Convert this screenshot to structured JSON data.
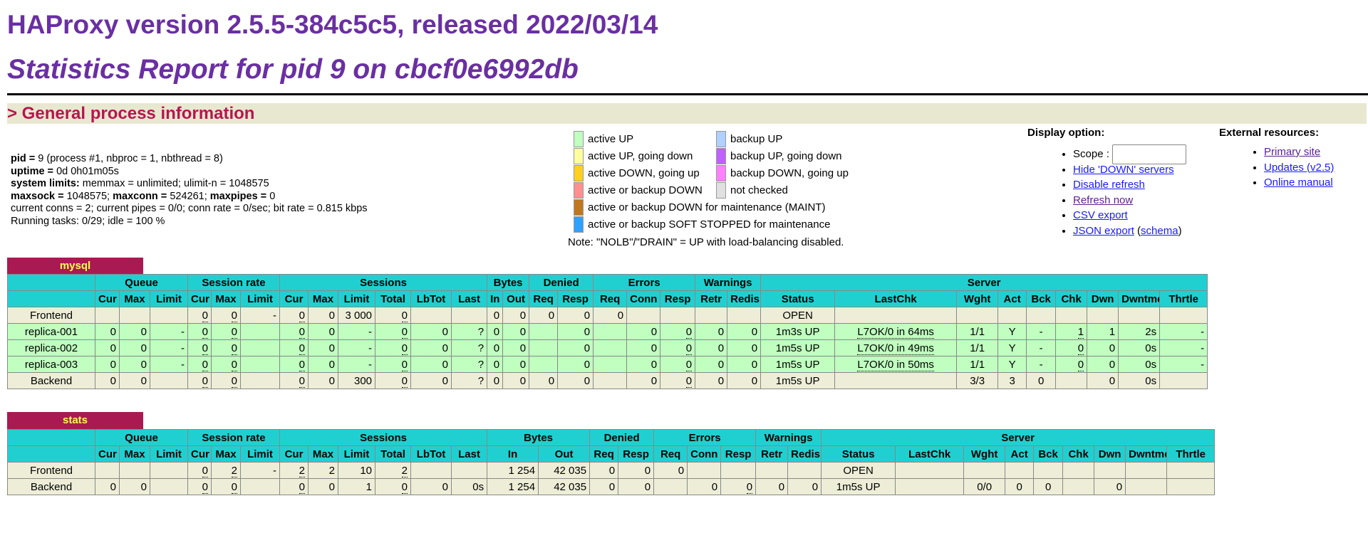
{
  "header": {
    "title": "HAProxy version 2.5.5-384c5c5, released 2022/03/14",
    "subtitle": "Statistics Report for pid 9 on cbcf0e6992db"
  },
  "section": {
    "title": "> General process information"
  },
  "process_info": [
    {
      "bold": "pid = ",
      "rest": "9 (process #1, nbproc = 1, nbthread = 8)"
    },
    {
      "bold": "uptime = ",
      "rest": "0d 0h01m05s"
    },
    {
      "bold": "system limits: ",
      "rest": "memmax = unlimited; ulimit-n = 1048575"
    },
    {
      "bold": "maxsock = ",
      "rest": "1048575; ",
      "bold2": "maxconn = ",
      "rest2": "524261; ",
      "bold3": "maxpipes = ",
      "rest3": "0"
    },
    {
      "bold": "",
      "rest": "current conns = 2; current pipes = 0/0; conn rate = 0/sec; bit rate = 0.815 kbps"
    },
    {
      "bold": "",
      "rest": "Running tasks: 0/29; idle = 100 %"
    }
  ],
  "legend": {
    "left": [
      {
        "label": "active UP",
        "color": "#c0ffc0"
      },
      {
        "label": "active UP, going down",
        "color": "#ffffa0"
      },
      {
        "label": "active DOWN, going up",
        "color": "#ffd020"
      },
      {
        "label": "active or backup DOWN",
        "color": "#ff9090"
      },
      {
        "label": "active or backup DOWN for maintenance (MAINT)",
        "color": "#c07820"
      },
      {
        "label": "active or backup SOFT STOPPED for maintenance",
        "color": "#30a0ff"
      }
    ],
    "right": [
      {
        "label": "backup UP",
        "color": "#b0d0ff"
      },
      {
        "label": "backup UP, going down",
        "color": "#c060ff"
      },
      {
        "label": "backup DOWN, going up",
        "color": "#ff80ff"
      },
      {
        "label": "not checked",
        "color": "#e0e0e0"
      }
    ],
    "note": "Note: \"NOLB\"/\"DRAIN\" = UP with load-balancing disabled."
  },
  "display_options": {
    "title": "Display option:",
    "scope_label": "Scope :",
    "scope_value": "",
    "links": [
      "Hide 'DOWN' servers",
      "Disable refresh",
      "Refresh now",
      "CSV export",
      "JSON export",
      "schema"
    ]
  },
  "external_resources": {
    "title": "External resources:",
    "links": [
      "Primary site",
      "Updates (v2.5)",
      "Online manual"
    ]
  },
  "headers_top": [
    "",
    "Queue",
    "Session rate",
    "Sessions",
    "Bytes",
    "Denied",
    "Errors",
    "Warnings",
    "Server"
  ],
  "headers_sub": [
    "",
    "Cur",
    "Max",
    "Limit",
    "Cur",
    "Max",
    "Limit",
    "Cur",
    "Max",
    "Limit",
    "Total",
    "LbTot",
    "Last",
    "In",
    "Out",
    "Req",
    "Resp",
    "Req",
    "Conn",
    "Resp",
    "Retr",
    "Redis",
    "Status",
    "LastChk",
    "Wght",
    "Act",
    "Bck",
    "Chk",
    "Dwn",
    "Dwntme",
    "Thrtle"
  ],
  "proxies": [
    {
      "name": "mysql",
      "rows": [
        {
          "type": "frontend",
          "cells": [
            "Frontend",
            "",
            "",
            "",
            "0",
            "0",
            "-",
            "0",
            "0",
            "3 000",
            "0",
            "",
            "",
            "0",
            "0",
            "0",
            "0",
            "0",
            "",
            "",
            "",
            "",
            "OPEN",
            "",
            "",
            "",
            "",
            "",
            "",
            "",
            ""
          ]
        },
        {
          "type": "up",
          "cells": [
            "replica-001",
            "0",
            "0",
            "-",
            "0",
            "0",
            "",
            "0",
            "0",
            "-",
            "0",
            "0",
            "?",
            "0",
            "0",
            "",
            "0",
            "",
            "0",
            "0",
            "0",
            "0",
            "1m3s UP",
            "L7OK/0 in 64ms",
            "1/1",
            "Y",
            "-",
            "1",
            "1",
            "2s",
            "-"
          ]
        },
        {
          "type": "up",
          "cells": [
            "replica-002",
            "0",
            "0",
            "-",
            "0",
            "0",
            "",
            "0",
            "0",
            "-",
            "0",
            "0",
            "?",
            "0",
            "0",
            "",
            "0",
            "",
            "0",
            "0",
            "0",
            "0",
            "1m5s UP",
            "L7OK/0 in 49ms",
            "1/1",
            "Y",
            "-",
            "0",
            "0",
            "0s",
            "-"
          ]
        },
        {
          "type": "up",
          "cells": [
            "replica-003",
            "0",
            "0",
            "-",
            "0",
            "0",
            "",
            "0",
            "0",
            "-",
            "0",
            "0",
            "?",
            "0",
            "0",
            "",
            "0",
            "",
            "0",
            "0",
            "0",
            "0",
            "1m5s UP",
            "L7OK/0 in 50ms",
            "1/1",
            "Y",
            "-",
            "0",
            "0",
            "0s",
            "-"
          ]
        },
        {
          "type": "backend",
          "cells": [
            "Backend",
            "0",
            "0",
            "",
            "0",
            "0",
            "",
            "0",
            "0",
            "300",
            "0",
            "0",
            "?",
            "0",
            "0",
            "0",
            "0",
            "",
            "0",
            "0",
            "0",
            "0",
            "1m5s UP",
            "",
            "3/3",
            "3",
            "0",
            "",
            "0",
            "0s",
            ""
          ]
        }
      ]
    },
    {
      "name": "stats",
      "rows": [
        {
          "type": "frontend",
          "cells": [
            "Frontend",
            "",
            "",
            "",
            "0",
            "2",
            "-",
            "2",
            "2",
            "10",
            "2",
            "",
            "",
            "1 254",
            "42 035",
            "0",
            "0",
            "0",
            "",
            "",
            "",
            "",
            "OPEN",
            "",
            "",
            "",
            "",
            "",
            "",
            "",
            ""
          ]
        },
        {
          "type": "backend",
          "cells": [
            "Backend",
            "0",
            "0",
            "",
            "0",
            "0",
            "",
            "0",
            "0",
            "1",
            "0",
            "0",
            "0s",
            "1 254",
            "42 035",
            "0",
            "0",
            "",
            "0",
            "0",
            "0",
            "0",
            "1m5s UP",
            "",
            "0/0",
            "0",
            "0",
            "",
            "0",
            "",
            ""
          ]
        }
      ]
    }
  ]
}
